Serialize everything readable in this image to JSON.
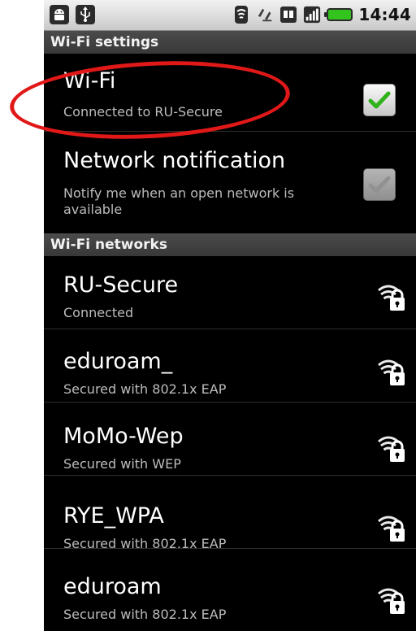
{
  "status_bar": {
    "time": "14:44",
    "icons": [
      "android-debug-icon",
      "usb-icon",
      "wifi-icon",
      "sync-icon",
      "sd-card-icon",
      "signal-icon",
      "battery-icon"
    ]
  },
  "wifi_settings": {
    "header": "Wi-Fi settings",
    "wifi": {
      "title": "Wi-Fi",
      "summary": "Connected to RU-Secure",
      "checked": true
    },
    "notification": {
      "title": "Network notification",
      "summary": "Notify me when an open network is available",
      "checked": true,
      "enabled": false
    }
  },
  "networks": {
    "header": "Wi-Fi networks",
    "items": [
      {
        "ssid": "RU-Secure",
        "status": "Connected",
        "icon": "wifi-lock-icon"
      },
      {
        "ssid": "eduroam_",
        "status": "Secured with 802.1x EAP",
        "icon": "wifi-lock-icon"
      },
      {
        "ssid": "MoMo-Wep",
        "status": "Secured with WEP",
        "icon": "wifi-lock-icon"
      },
      {
        "ssid": "RYE_WPA",
        "status": "Secured with 802.1x EAP",
        "icon": "wifi-lock-icon"
      },
      {
        "ssid": "eduroam",
        "status": "Secured with 802.1x EAP",
        "icon": "wifi-lock-icon"
      }
    ]
  },
  "colors": {
    "highlight": "#e11818",
    "check_green": "#2fb21a",
    "battery": "#34c41e",
    "background": "#000000"
  }
}
